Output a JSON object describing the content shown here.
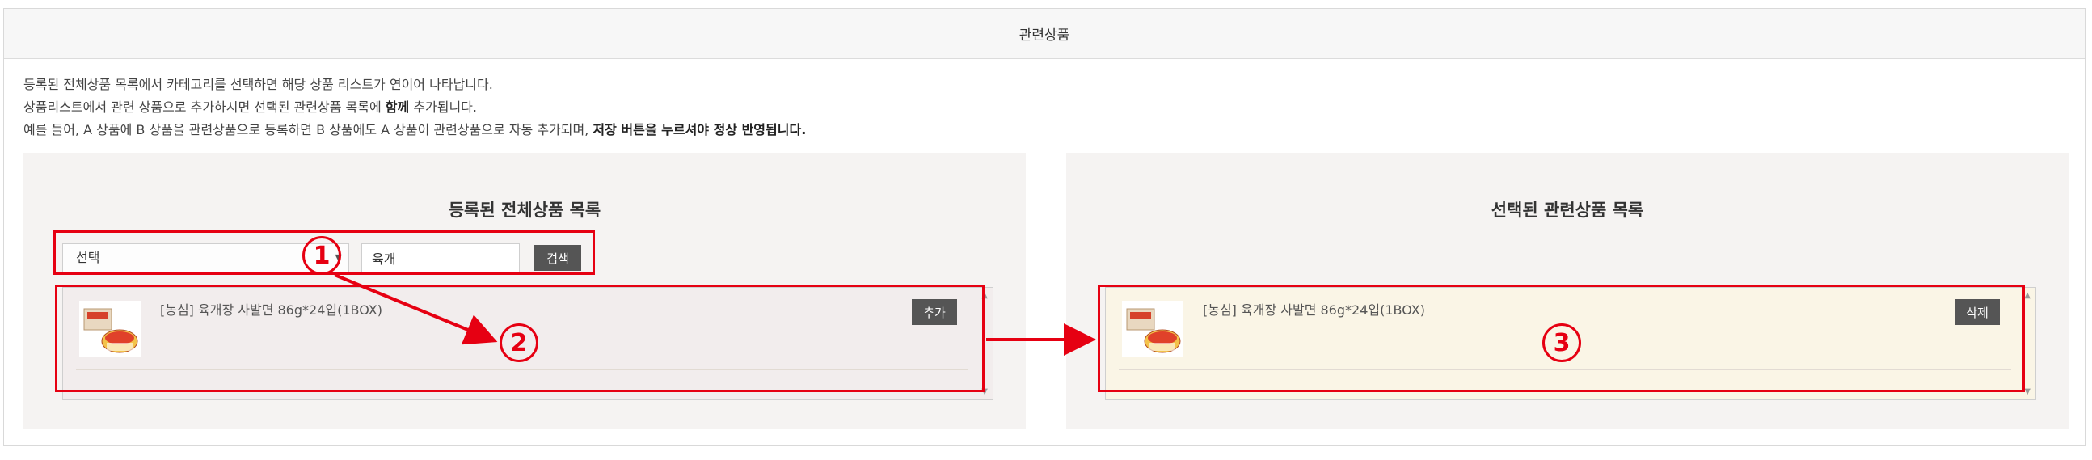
{
  "header": {
    "title": "관련상품"
  },
  "description": {
    "line1": "등록된 전체상품 목록에서 카테고리를 선택하면 해당 상품 리스트가 연이어 나타납니다.",
    "line2_pre": "상품리스트에서 관련 상품으로 추가하시면 선택된 관련상품 목록에 ",
    "line2_bold": "함께",
    "line2_post": " 추가됩니다.",
    "line3_pre": "예를 들어, A 상품에 B 상품을 관련상품으로 등록하면 B 상품에도 A 상품이 관련상품으로 자동 추가되며, ",
    "line3_bold": "저장 버튼을 누르셔야 정상 반영됩니다."
  },
  "left_panel": {
    "title": "등록된 전체상품 목록",
    "category_select": "선택",
    "search_value": "육개",
    "search_button": "검색",
    "item": {
      "name": "[농심] 육개장 사발면 86g*24입(1BOX)",
      "action": "추가"
    }
  },
  "right_panel": {
    "title": "선택된 관련상품 목록",
    "item": {
      "name": "[농심] 육개장 사발면 86g*24입(1BOX)",
      "action": "삭제"
    }
  },
  "annotations": {
    "step1": "1",
    "step2": "2",
    "step3": "3",
    "color": "#e60012"
  },
  "colors": {
    "accent_red": "#e60012",
    "button_dark": "#555555",
    "left_list_bg": "#f2eded",
    "right_list_bg": "#faf5e6"
  }
}
